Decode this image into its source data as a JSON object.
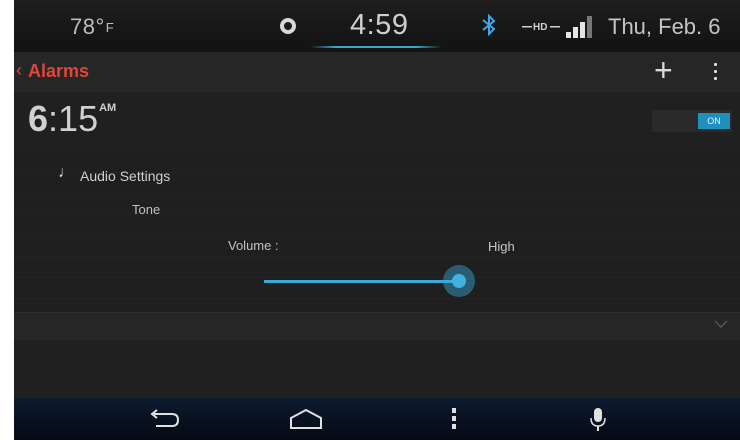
{
  "status_bar": {
    "temperature": "78°",
    "temperature_unit": "F",
    "time": "4:59",
    "hd_label": "HD",
    "date": "Thu, Feb. 6"
  },
  "action_bar": {
    "back_symbol": "‹",
    "title": "Alarms",
    "add_symbol": "+"
  },
  "alarm": {
    "hour": "6",
    "separator": ":",
    "minutes": "15",
    "ampm": "AM",
    "toggle_label": "ON",
    "enabled": true
  },
  "audio_settings": {
    "icon": "music-note-icon",
    "label": "Audio Settings",
    "tone_label": "Tone",
    "volume_label": "Volume :",
    "volume_value": "High",
    "volume_level": 0.65
  },
  "colors": {
    "accent": "#3fb2e0",
    "title": "#e0473a"
  },
  "nav": {
    "items": [
      "back-icon",
      "home-icon",
      "menu-icon",
      "microphone-icon"
    ]
  }
}
